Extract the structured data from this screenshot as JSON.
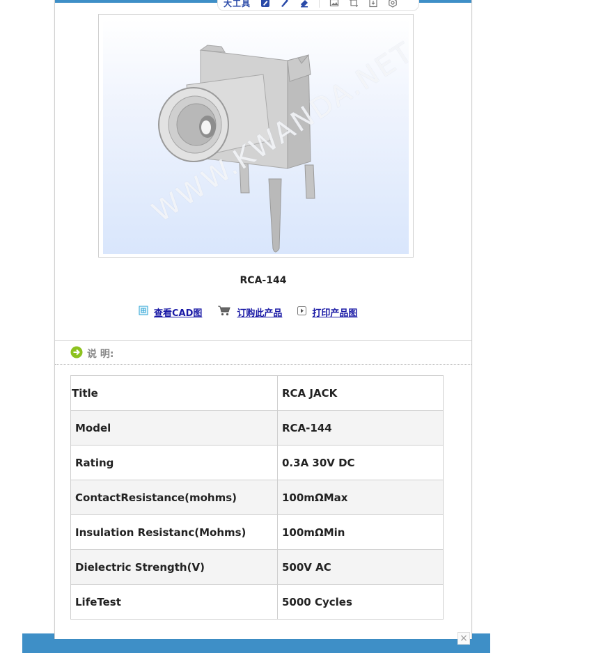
{
  "toolbar": {
    "label": "大工具",
    "icons": [
      "edit-icon",
      "pen-icon",
      "eraser-icon",
      "image-icon",
      "crop-icon",
      "download-icon",
      "settings-icon"
    ]
  },
  "product": {
    "image_watermark": "WWW.KWANDA.NET",
    "model_caption": "RCA-144"
  },
  "actions": [
    {
      "label": "查看CAD图",
      "icon": "cad-icon"
    },
    {
      "label": "订购此产品",
      "icon": "cart-icon"
    },
    {
      "label": "打印产品图",
      "icon": "print-icon"
    }
  ],
  "section": {
    "title": "说 明:"
  },
  "specs": [
    {
      "name": "Title",
      "value": "RCA JACK"
    },
    {
      "name": "Model",
      "value": "RCA-144"
    },
    {
      "name": "Rating",
      "value": "0.3A 30V DC"
    },
    {
      "name": "ContactResistance(mohms)",
      "value": "100mΩMax"
    },
    {
      "name": "Insulation Resistanc(Mohms)",
      "value": "100mΩMin"
    },
    {
      "name": "Dielectric Strength(V)",
      "value": "500V AC"
    },
    {
      "name": "LifeTest",
      "value": "5000 Cycles"
    }
  ],
  "colors": {
    "accent_bar": "#3e8fc7",
    "link": "#1a1aa6",
    "go_icon": "#8dc21f"
  },
  "close_glyph": "×"
}
